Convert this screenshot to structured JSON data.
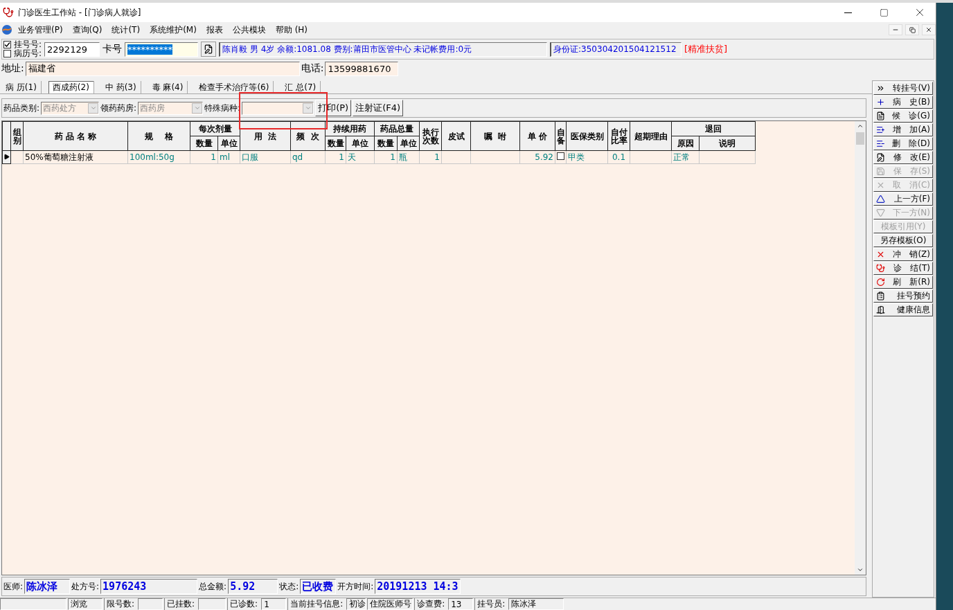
{
  "window": {
    "title": "门诊医生工作站 - [门诊病人就诊]"
  },
  "menu": [
    "业务管理(P)",
    "查询(Q)",
    "统计(T)",
    "系统维护(M)",
    "报表",
    "公共模块",
    "帮助 (H)"
  ],
  "patient": {
    "register_check": {
      "label": "挂号号:",
      "checked": true
    },
    "record_check": {
      "label": "病历号:",
      "checked": false
    },
    "number": "2292129",
    "card_label": "卡号",
    "card_value": "**********",
    "info": "陈肖毅 男 4岁 余额:1081.08 费别:莆田市医管中心 未记帐费用:0元",
    "id_card": "身份证:350304201504121512",
    "tag": "[精准扶贫]"
  },
  "address": {
    "label": "地址:",
    "value": "福建省",
    "phone_label": "电话:",
    "phone": "13599881670"
  },
  "tabs": [
    {
      "label": "病 历(1)",
      "selected": false
    },
    {
      "label": "西成药(2)",
      "selected": true
    },
    {
      "label": "中 药(3)",
      "selected": false
    },
    {
      "label": "毒 麻(4)",
      "selected": false
    },
    {
      "label": "检查手术治疗等(6)",
      "selected": false
    },
    {
      "label": "汇 总(7)",
      "selected": false
    }
  ],
  "toolbar": {
    "drug_type_label": "药品类别:",
    "drug_type": "西药处方",
    "pharmacy_label": "领药药房:",
    "pharmacy": "西药房",
    "disease_label": "特殊病种:",
    "buttons": [
      "打印(P)",
      "注射证(F4)"
    ]
  },
  "table": {
    "columns": [
      {
        "label": "组别"
      },
      {
        "label": "药 品 名 称"
      },
      {
        "label": "规    格"
      },
      {
        "label": "每次剂量",
        "sub": [
          "数量",
          "单位"
        ]
      },
      {
        "label": "用  法"
      },
      {
        "label": "频  次"
      },
      {
        "label": "持续用药",
        "sub": [
          "数量",
          "单位"
        ]
      },
      {
        "label": "药品总量",
        "sub": [
          "数量",
          "单位"
        ]
      },
      {
        "label": "执行次数"
      },
      {
        "label": "皮试"
      },
      {
        "label": "嘱  咐"
      },
      {
        "label": "单 价"
      },
      {
        "label": "自备"
      },
      {
        "label": "医保类别"
      },
      {
        "label": "自付比率"
      },
      {
        "label": "超期理由"
      },
      {
        "label": "退回",
        "sub": [
          "原因",
          "说明"
        ]
      }
    ],
    "rows": [
      {
        "selected": true,
        "drug_name": "50%葡萄糖注射液",
        "spec": "100ml:50g",
        "dose_qty": "1",
        "dose_unit": "ml",
        "usage": "口服",
        "frequency": "qd",
        "duration_qty": "1",
        "duration_unit": "天",
        "total_qty": "1",
        "total_unit": "瓶",
        "exec_count": "1",
        "unit_price": "5.92",
        "self_provided": false,
        "insurance_class": "甲类",
        "self_pay_ratio": "0.1",
        "return_reason": "正常"
      }
    ]
  },
  "side_buttons": [
    {
      "label": "转挂号(V)",
      "disabled": false
    },
    {
      "label": "病　史(B)",
      "disabled": false
    },
    {
      "label": "候　诊(G)",
      "disabled": false
    },
    {
      "label": "增　加(A)",
      "disabled": false
    },
    {
      "label": "删　除(D)",
      "disabled": false
    },
    {
      "label": "修　改(E)",
      "disabled": false
    },
    {
      "label": "保　存(S)",
      "disabled": true
    },
    {
      "label": "取　消(C)",
      "disabled": true
    },
    {
      "label": "上一方(F)",
      "disabled": false
    },
    {
      "label": "下一方(N)",
      "disabled": true
    },
    {
      "label": "模板引用(Y)",
      "disabled": true
    },
    {
      "label": "另存模板(O)",
      "disabled": false
    },
    {
      "label": "冲　销(Z)",
      "disabled": false
    },
    {
      "label": "诊　结(T)",
      "disabled": false
    },
    {
      "label": "刷　新(R)",
      "disabled": false
    },
    {
      "label": "挂号预约",
      "disabled": false
    },
    {
      "label": "健康信息",
      "disabled": false
    }
  ],
  "footer": [
    {
      "label": "医师:",
      "value": "陈冰泽"
    },
    {
      "label": "处方号:",
      "value": "1976243"
    },
    {
      "label": "总金额:",
      "value": "5.92"
    },
    {
      "label": "状态:",
      "value": "已收费"
    },
    {
      "label": "开方时间:",
      "value": "20191213 14:3"
    }
  ],
  "status_bar": {
    "mode": "浏览",
    "fields": [
      {
        "label": "限号数:"
      },
      {
        "label": "已挂数:"
      },
      {
        "label": "已诊数:",
        "value": "1"
      },
      {
        "label": "当前挂号信息:",
        "value": "初诊"
      },
      {
        "value": "住院医师号"
      },
      {
        "label": "诊查费:",
        "value": "13"
      },
      {
        "label": "挂号员:",
        "value": "陈冰泽"
      }
    ]
  }
}
